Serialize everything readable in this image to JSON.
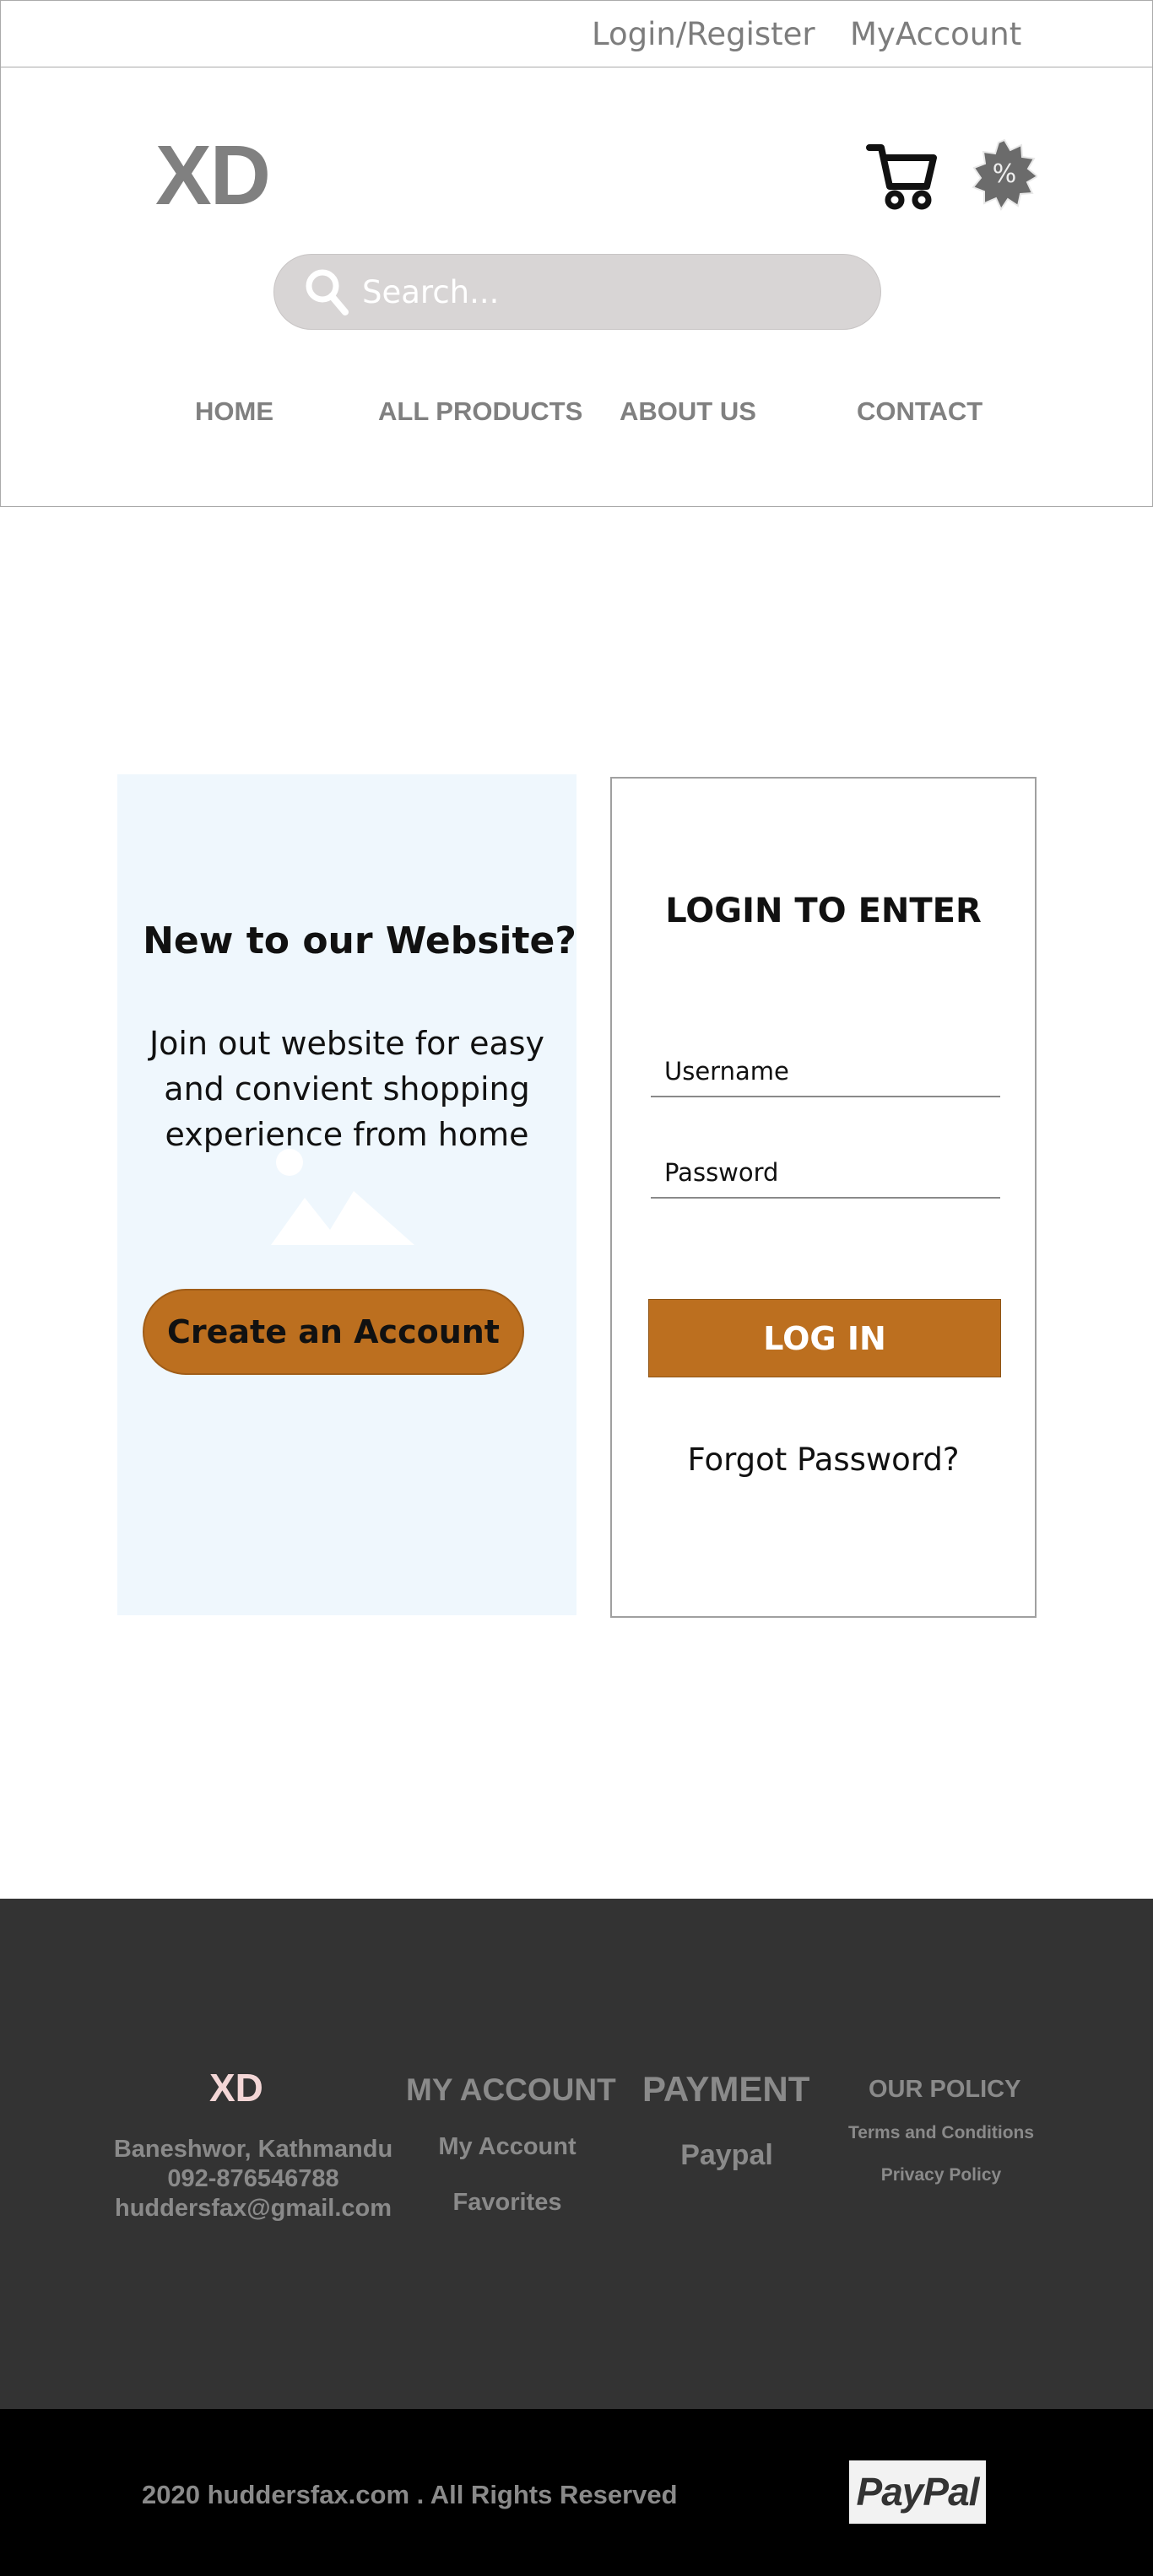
{
  "topbar": {
    "login_register": "Login/Register",
    "my_account": "MyAccount"
  },
  "header": {
    "logo": "XD",
    "search_placeholder": "Search...",
    "cart_icon": "cart-icon",
    "sale_icon": "discount-badge-icon",
    "nav": [
      "HOME",
      "ALL PRODUCTS",
      "ABOUT US",
      "CONTACT"
    ]
  },
  "promo": {
    "title": "New to our Website?",
    "text": "Join out website for easy\nand convient shopping\nexperience from home",
    "button": "Create an Account",
    "image_icon": "image-placeholder-icon"
  },
  "login": {
    "title": "LOGIN TO ENTER",
    "username_placeholder": "Username",
    "password_placeholder": "Password",
    "button": "LOG IN",
    "forgot": "Forgot Password?"
  },
  "footer": {
    "logo": "XD",
    "contact_address": "Baneshwor, Kathmandu",
    "contact_phone": "092-876546788",
    "contact_email": "huddersfax@gmail.com",
    "account_title": "MY ACCOUNT",
    "account_links": [
      "My Account",
      "Favorites"
    ],
    "payment_title": "PAYMENT",
    "payment_links": [
      "Paypal"
    ],
    "policy_title": "OUR POLICY",
    "policy_links": [
      "Terms and Conditions",
      "Privacy Policy"
    ],
    "copyright": "2020 huddersfax.com . All Rights Reserved",
    "paypal_logo": "PayPal"
  },
  "colors": {
    "accent": "#bc6f1f",
    "footer_bg": "#333333",
    "bottom_bg": "#000000",
    "promo_bg": "#eff7fd",
    "muted_text": "#808080"
  }
}
